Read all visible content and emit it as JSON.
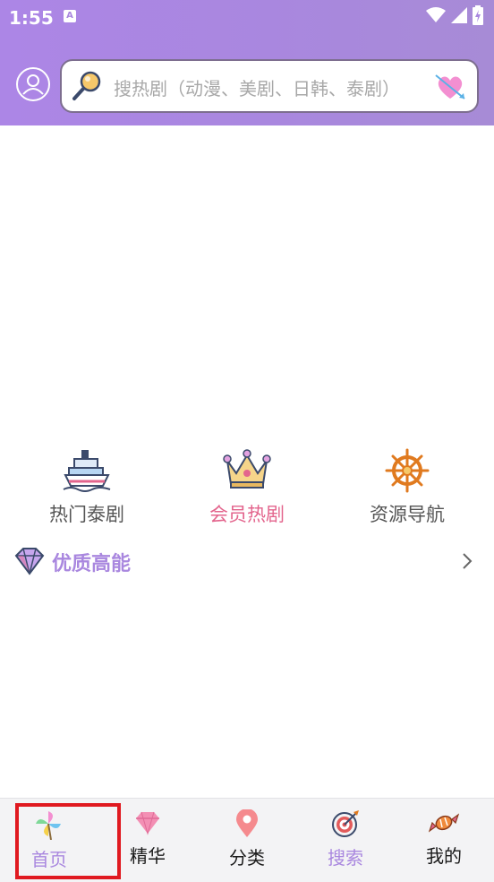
{
  "status_bar": {
    "time": "1:55",
    "notification_letter": "A"
  },
  "header": {
    "avatar_icon": "user-avatar-icon",
    "search": {
      "placeholder": "搜热剧（动漫、美剧、日韩、泰剧）"
    }
  },
  "quick_nav": [
    {
      "label": "热门泰剧",
      "icon": "ship-icon"
    },
    {
      "label": "会员热剧",
      "icon": "crown-icon",
      "active": true
    },
    {
      "label": "资源导航",
      "icon": "ship-wheel-icon"
    }
  ],
  "section": {
    "title": "优质高能",
    "icon": "diamond-icon"
  },
  "tabbar": {
    "tabs": [
      {
        "label": "首页",
        "icon": "pinwheel-icon"
      },
      {
        "label": "精华",
        "icon": "gem-icon"
      },
      {
        "label": "分类",
        "icon": "location-pin-icon"
      },
      {
        "label": "搜索",
        "icon": "target-icon",
        "selected": true
      },
      {
        "label": "我的",
        "icon": "candy-icon"
      }
    ]
  },
  "colors": {
    "header_bg": "#a987df",
    "accent": "#a987df",
    "active_pink": "#e3658d",
    "highlight": "#e01920"
  }
}
